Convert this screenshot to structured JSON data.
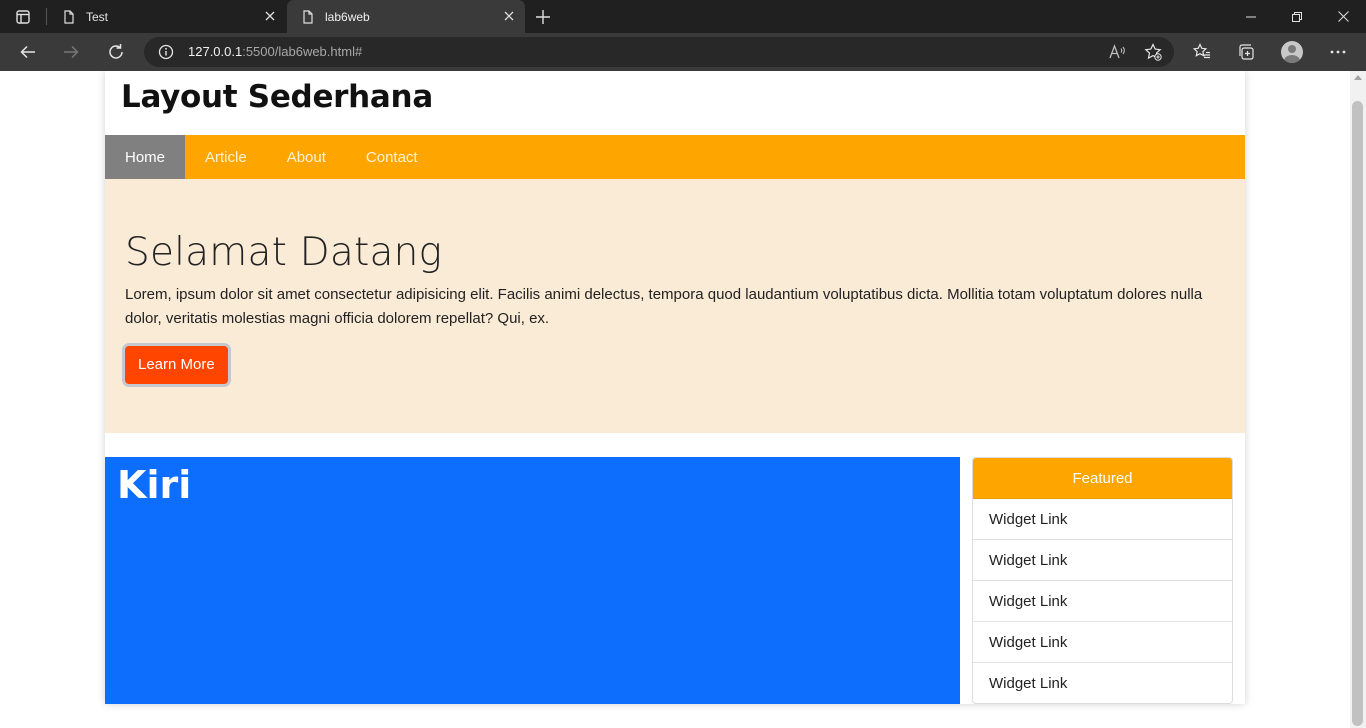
{
  "browser": {
    "tabs": [
      {
        "title": "Test"
      },
      {
        "title": "lab6web"
      }
    ],
    "url": {
      "host": "127.0.0.1",
      "rest": ":5500/lab6web.html#"
    }
  },
  "page": {
    "header": {
      "title": "Layout Sederhana"
    },
    "nav": {
      "items": [
        {
          "label": "Home"
        },
        {
          "label": "Article"
        },
        {
          "label": "About"
        },
        {
          "label": "Contact"
        }
      ],
      "accent": "#ffa500",
      "active_bg": "#808080"
    },
    "hero": {
      "title": "Selamat Datang",
      "text": "Lorem, ipsum dolor sit amet consectetur adipisicing elit. Facilis animi delectus, tempora quod laudantium voluptatibus dicta. Mollitia totam voluptatum dolores nulla dolor, veritatis molestias magni officia dolorem repellat? Qui, ex.",
      "button": "Learn More",
      "bg": "#faebd7",
      "button_color": "#ff4500"
    },
    "main": {
      "title": "Kiri",
      "bg": "#0d6efd"
    },
    "widget": {
      "header": "Featured",
      "links": [
        {
          "label": "Widget Link"
        },
        {
          "label": "Widget Link"
        },
        {
          "label": "Widget Link"
        },
        {
          "label": "Widget Link"
        },
        {
          "label": "Widget Link"
        }
      ]
    }
  }
}
